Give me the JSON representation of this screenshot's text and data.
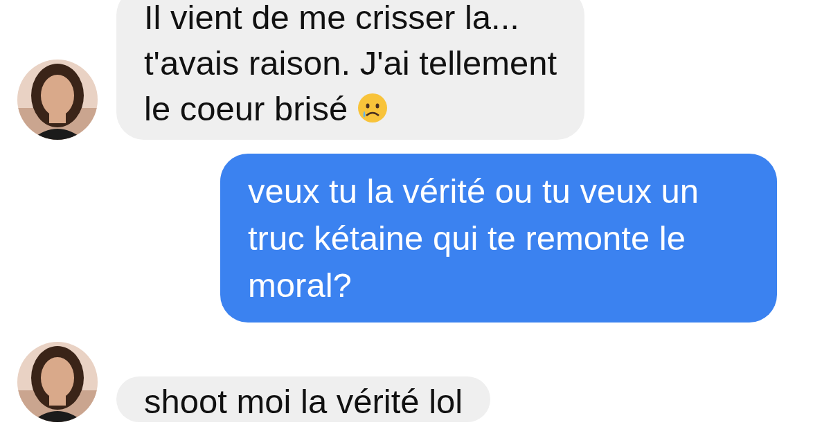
{
  "messages": [
    {
      "kind": "received",
      "text": "Il vient de me crisser la...\nt'avais raison. J'ai tellement\nle coeur brisé",
      "has_emoji": true
    },
    {
      "kind": "sent",
      "text": "veux tu la vérité ou tu veux un\ntruc kétaine qui te remonte le\nmoral?"
    },
    {
      "kind": "received",
      "text": "shoot moi la vérité lol"
    }
  ]
}
